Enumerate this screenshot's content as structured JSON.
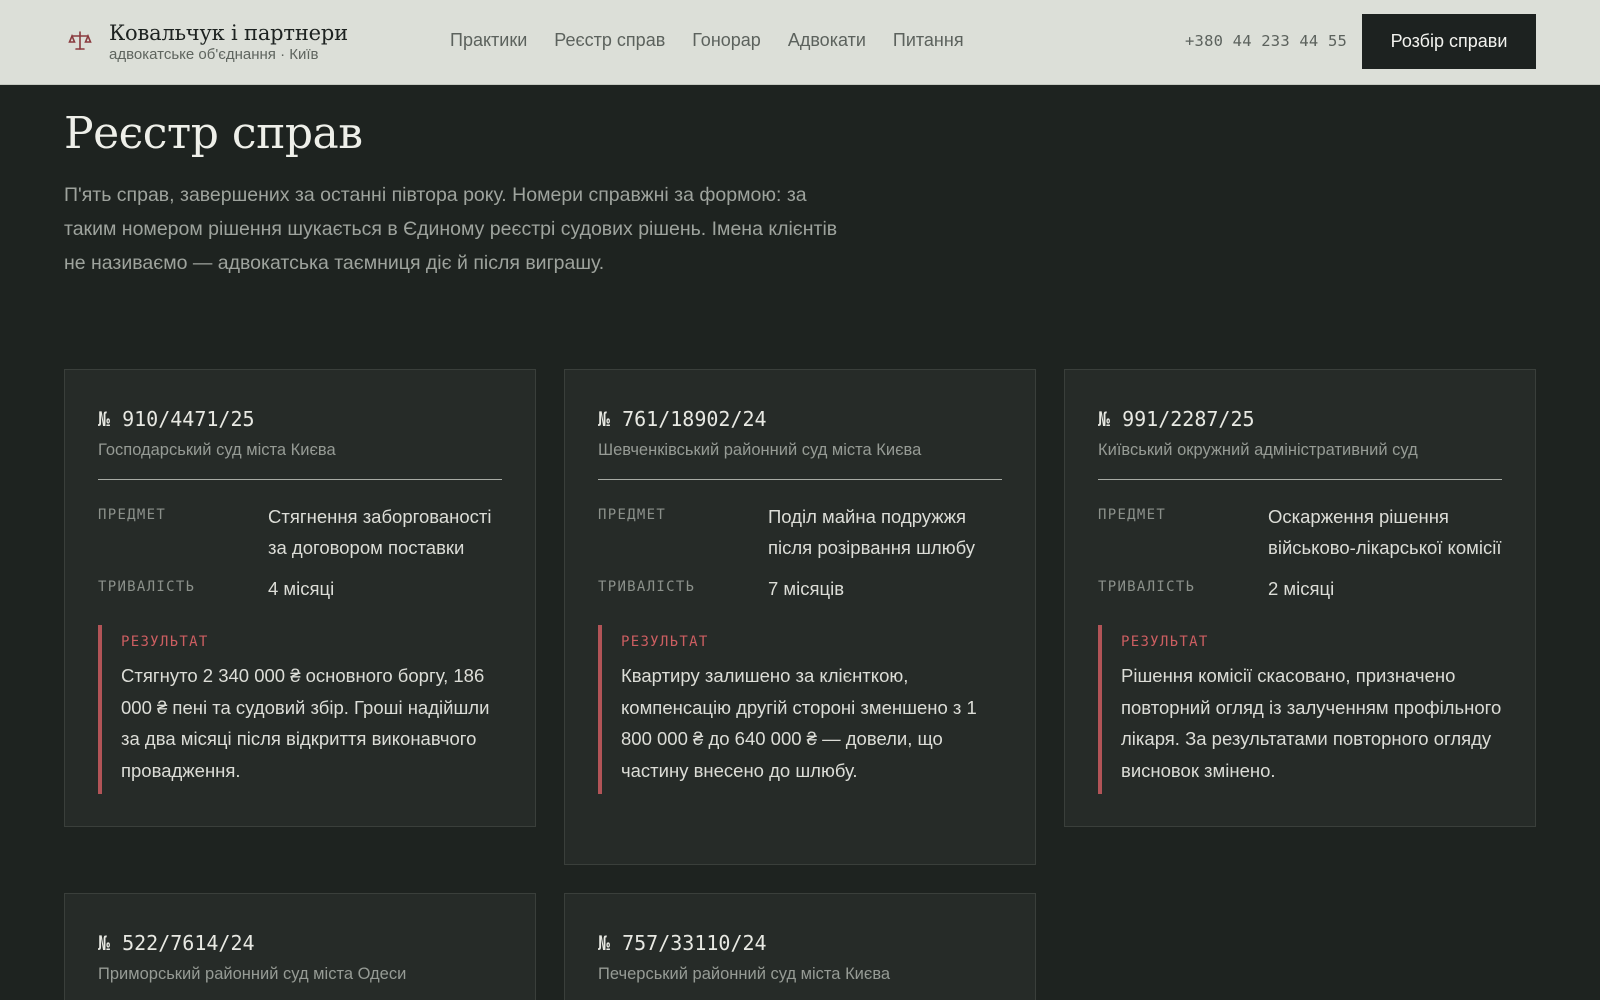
{
  "header": {
    "brand_name": "Ковальчук і партнери",
    "brand_sub": "адвокатське об'єднання · Київ",
    "nav": [
      "Практики",
      "Реєстр справ",
      "Гонорар",
      "Адвокати",
      "Питання"
    ],
    "phone": "+380 44 233 44 55",
    "cta_label": "Розбір справи"
  },
  "main": {
    "title": "Реєстр справ",
    "intro": "П'ять справ, завершених за останні півтора року. Номери справжні за формою: за таким номером рішення шукається в Єдиному реєстрі судових рішень. Імена клієнтів не називаємо — адвокатська таємниця діє й після виграшу."
  },
  "labels": {
    "subject": "ПРЕДМЕТ",
    "duration": "ТРИВАЛІСТЬ",
    "result": "РЕЗУЛЬТАТ"
  },
  "cases": [
    {
      "number": "№ 910/4471/25",
      "court": "Господарський суд міста Києва",
      "subject": "Стягнення заборгованості за договором поставки",
      "duration": "4 місяці",
      "result": "Стягнуто 2 340 000 ₴ основного боргу, 186 000 ₴ пені та судовий збір. Гроші надійшли за два місяці після відкриття виконавчого провадження."
    },
    {
      "number": "№ 761/18902/24",
      "court": "Шевченківський районний суд міста Києва",
      "subject": "Поділ майна подружжя після розірвання шлюбу",
      "duration": "7 місяців",
      "result": "Квартиру залишено за клієнткою, компенсацію другій стороні зменшено з 1 800 000 ₴ до 640 000 ₴ — довели, що частину внесено до шлюбу."
    },
    {
      "number": "№ 991/2287/25",
      "court": "Київський окружний адміністративний суд",
      "subject": "Оскарження рішення військово-лікарської комісії",
      "duration": "2 місяці",
      "result": "Рішення комісії скасовано, призначено повторний огляд із залученням профільного лікаря. За результатами повторного огляду висновок змінено."
    },
    {
      "number": "№ 522/7614/24",
      "court": "Приморський районний суд міста Одеси"
    },
    {
      "number": "№ 757/33110/24",
      "court": "Печерський районний суд міста Києва"
    }
  ],
  "colors": {
    "header_bg": "#dcdfd8",
    "page_bg": "#1e2320",
    "card_bg": "#262b28",
    "accent": "#b25457"
  }
}
